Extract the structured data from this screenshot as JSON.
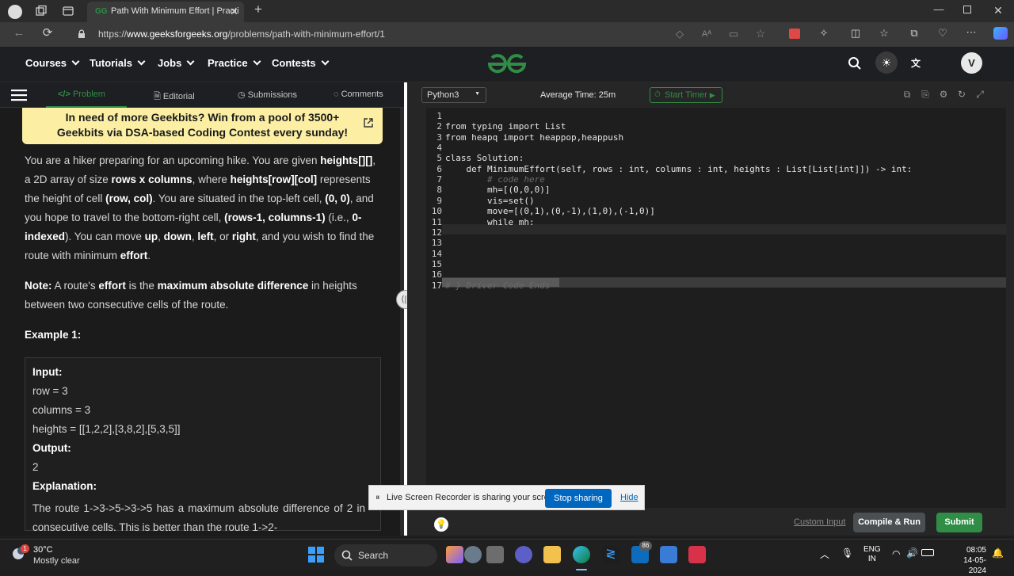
{
  "browser": {
    "tab_title": "Path With Minimum Effort | Practi",
    "url_prefix": "https://",
    "url_domain": "www.geeksforgeeks.org",
    "url_path": "/problems/path-with-minimum-effort/1"
  },
  "header": {
    "nav": [
      "Courses",
      "Tutorials",
      "Jobs",
      "Practice",
      "Contests"
    ],
    "logo": "GfG",
    "avatar": "V"
  },
  "left": {
    "tabs": {
      "problem": "Problem",
      "editorial": "Editorial",
      "submissions": "Submissions",
      "comments": "Comments"
    },
    "banner": "In need of more Geekbits? Win from a pool of 3500+ Geekbits via DSA-based Coding Contest every sunday!",
    "p1": [
      {
        "t": "You are a hiker preparing for an upcoming hike. You are given "
      },
      {
        "t": "heights[][]",
        "b": true
      },
      {
        "t": ", a 2D array of size "
      },
      {
        "t": "rows x columns",
        "b": true
      },
      {
        "t": ", where "
      },
      {
        "t": "heights[row][col]",
        "b": true
      },
      {
        "t": " represents the height of cell "
      },
      {
        "t": "(row, col)",
        "b": true
      },
      {
        "t": ". You are situated in the top-left cell, "
      },
      {
        "t": "(0, 0)",
        "b": true
      },
      {
        "t": ", and you hope to travel to the bottom-right cell, "
      },
      {
        "t": "(rows-1, columns-1)",
        "b": true
      },
      {
        "t": " (i.e., "
      },
      {
        "t": "0-indexed",
        "b": true
      },
      {
        "t": "). You can move "
      },
      {
        "t": "up",
        "b": true
      },
      {
        "t": ", "
      },
      {
        "t": "down",
        "b": true
      },
      {
        "t": ", "
      },
      {
        "t": "left",
        "b": true
      },
      {
        "t": ", or "
      },
      {
        "t": "right",
        "b": true
      },
      {
        "t": ", and you wish to find the route with minimum "
      },
      {
        "t": "effort",
        "b": true
      },
      {
        "t": "."
      }
    ],
    "p2": [
      {
        "t": "Note:",
        "b": true
      },
      {
        "t": " A route's "
      },
      {
        "t": "effort",
        "b": true
      },
      {
        "t": " is the "
      },
      {
        "t": "maximum absolute difference",
        "b": true
      },
      {
        "t": " in heights between two consecutive cells of the route."
      }
    ],
    "example_title": "Example 1:",
    "example": {
      "input_label": "Input:",
      "row": "row = 3",
      "columns": "columns = 3",
      "heights": "heights = [[1,2,2],[3,8,2],[5,3,5]]",
      "output_label": "Output:",
      "output": "2",
      "explanation_label": "Explanation:",
      "explanation": "The route 1->3->5->3->5 has a maximum absolute difference of 2 in consecutive cells. This is better than the route 1->2-"
    }
  },
  "editor": {
    "language": "Python3",
    "avg_time": "Average Time: 25m",
    "timer": "Start Timer",
    "code": [
      "",
      "from typing import List",
      "from heapq import heappop,heappush",
      "",
      "class Solution:",
      "    def MinimumEffort(self, rows : int, columns : int, heights : List[List[int]]) -> int:",
      "        # code here",
      "        mh=[(0,0,0)]",
      "        vis=set()",
      "        move=[(0,1),(0,-1),(1,0),(-1,0)]",
      "        while mh:",
      "",
      "",
      "",
      "",
      "",
      "# } Driver Code Ends"
    ],
    "custom_input": "Custom Input",
    "compile": "Compile & Run",
    "submit": "Submit"
  },
  "share": {
    "text": "Live Screen Recorder is sharing your screen.",
    "stop": "Stop sharing",
    "hide": "Hide"
  },
  "taskbar": {
    "temp": "30°C",
    "condition": "Mostly clear",
    "search": "Search",
    "badge": "86",
    "lang1": "ENG",
    "lang2": "IN",
    "time": "08:05",
    "date": "14-05-2024"
  }
}
